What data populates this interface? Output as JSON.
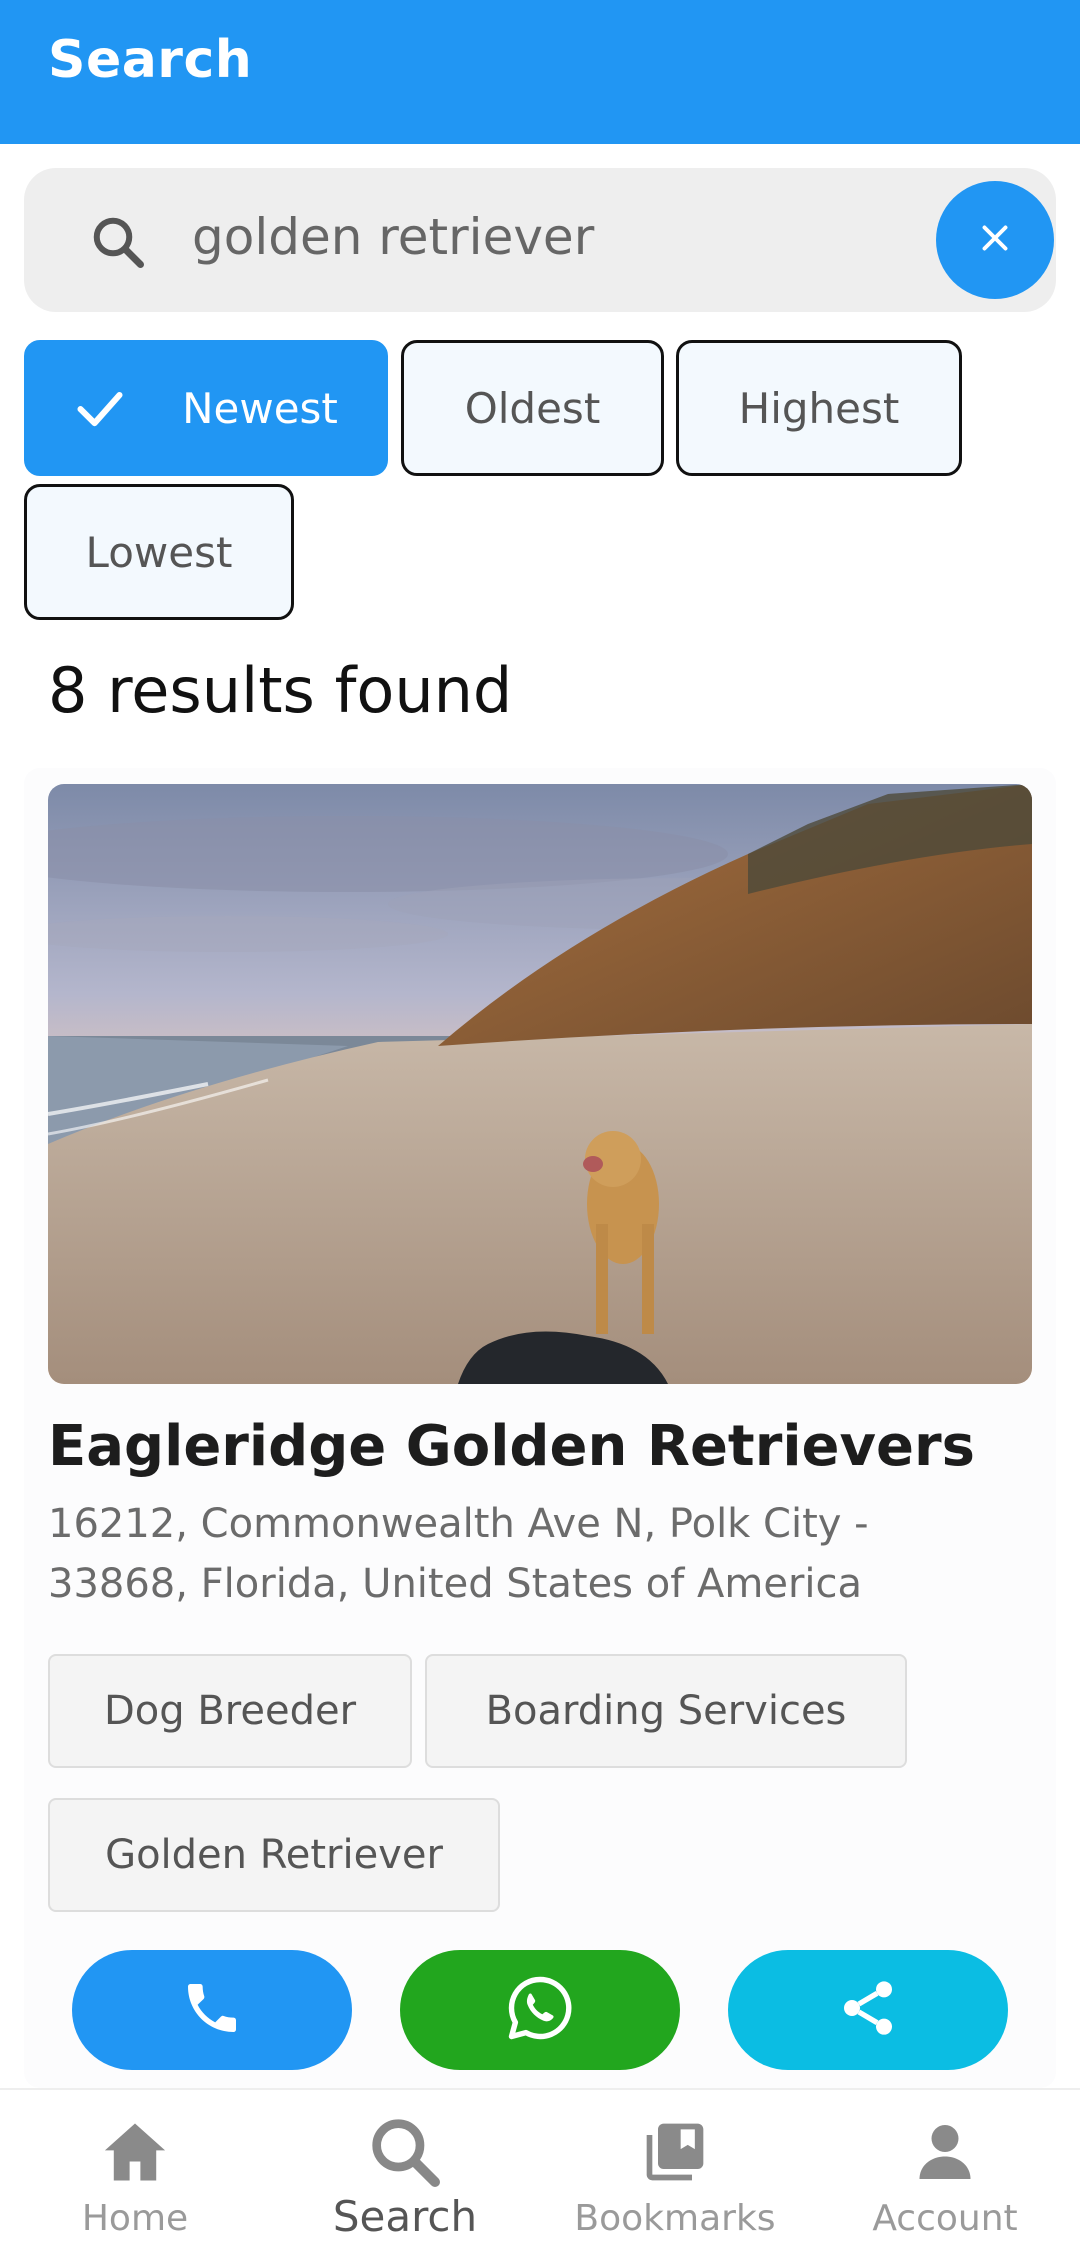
{
  "appbar": {
    "title": "Search"
  },
  "search": {
    "query": "golden retriever"
  },
  "sort_chips": [
    {
      "label": "Newest",
      "selected": true
    },
    {
      "label": "Oldest",
      "selected": false
    },
    {
      "label": "Highest",
      "selected": false
    },
    {
      "label": "Lowest",
      "selected": false
    }
  ],
  "results": {
    "count_text": "8 results found"
  },
  "listing": {
    "name": "Eagleridge Golden Retrievers",
    "address": "16212, Commonwealth Ave N, Polk City - 33868, Florida, United States of America",
    "tags": [
      "Dog Breeder",
      "Boarding Services",
      "Golden Retriever"
    ],
    "actions": [
      "phone-icon",
      "whatsapp-icon",
      "share-icon"
    ]
  },
  "bottom_nav": [
    {
      "label": "Home",
      "icon": "home-icon",
      "active": false
    },
    {
      "label": "Search",
      "icon": "search-icon",
      "active": true
    },
    {
      "label": "Bookmarks",
      "icon": "bookmarks-icon",
      "active": false
    },
    {
      "label": "Account",
      "icon": "account-icon",
      "active": false
    }
  ],
  "colors": {
    "primary": "#2196f3",
    "whatsapp": "#22a61e",
    "share": "#0bbde3"
  }
}
